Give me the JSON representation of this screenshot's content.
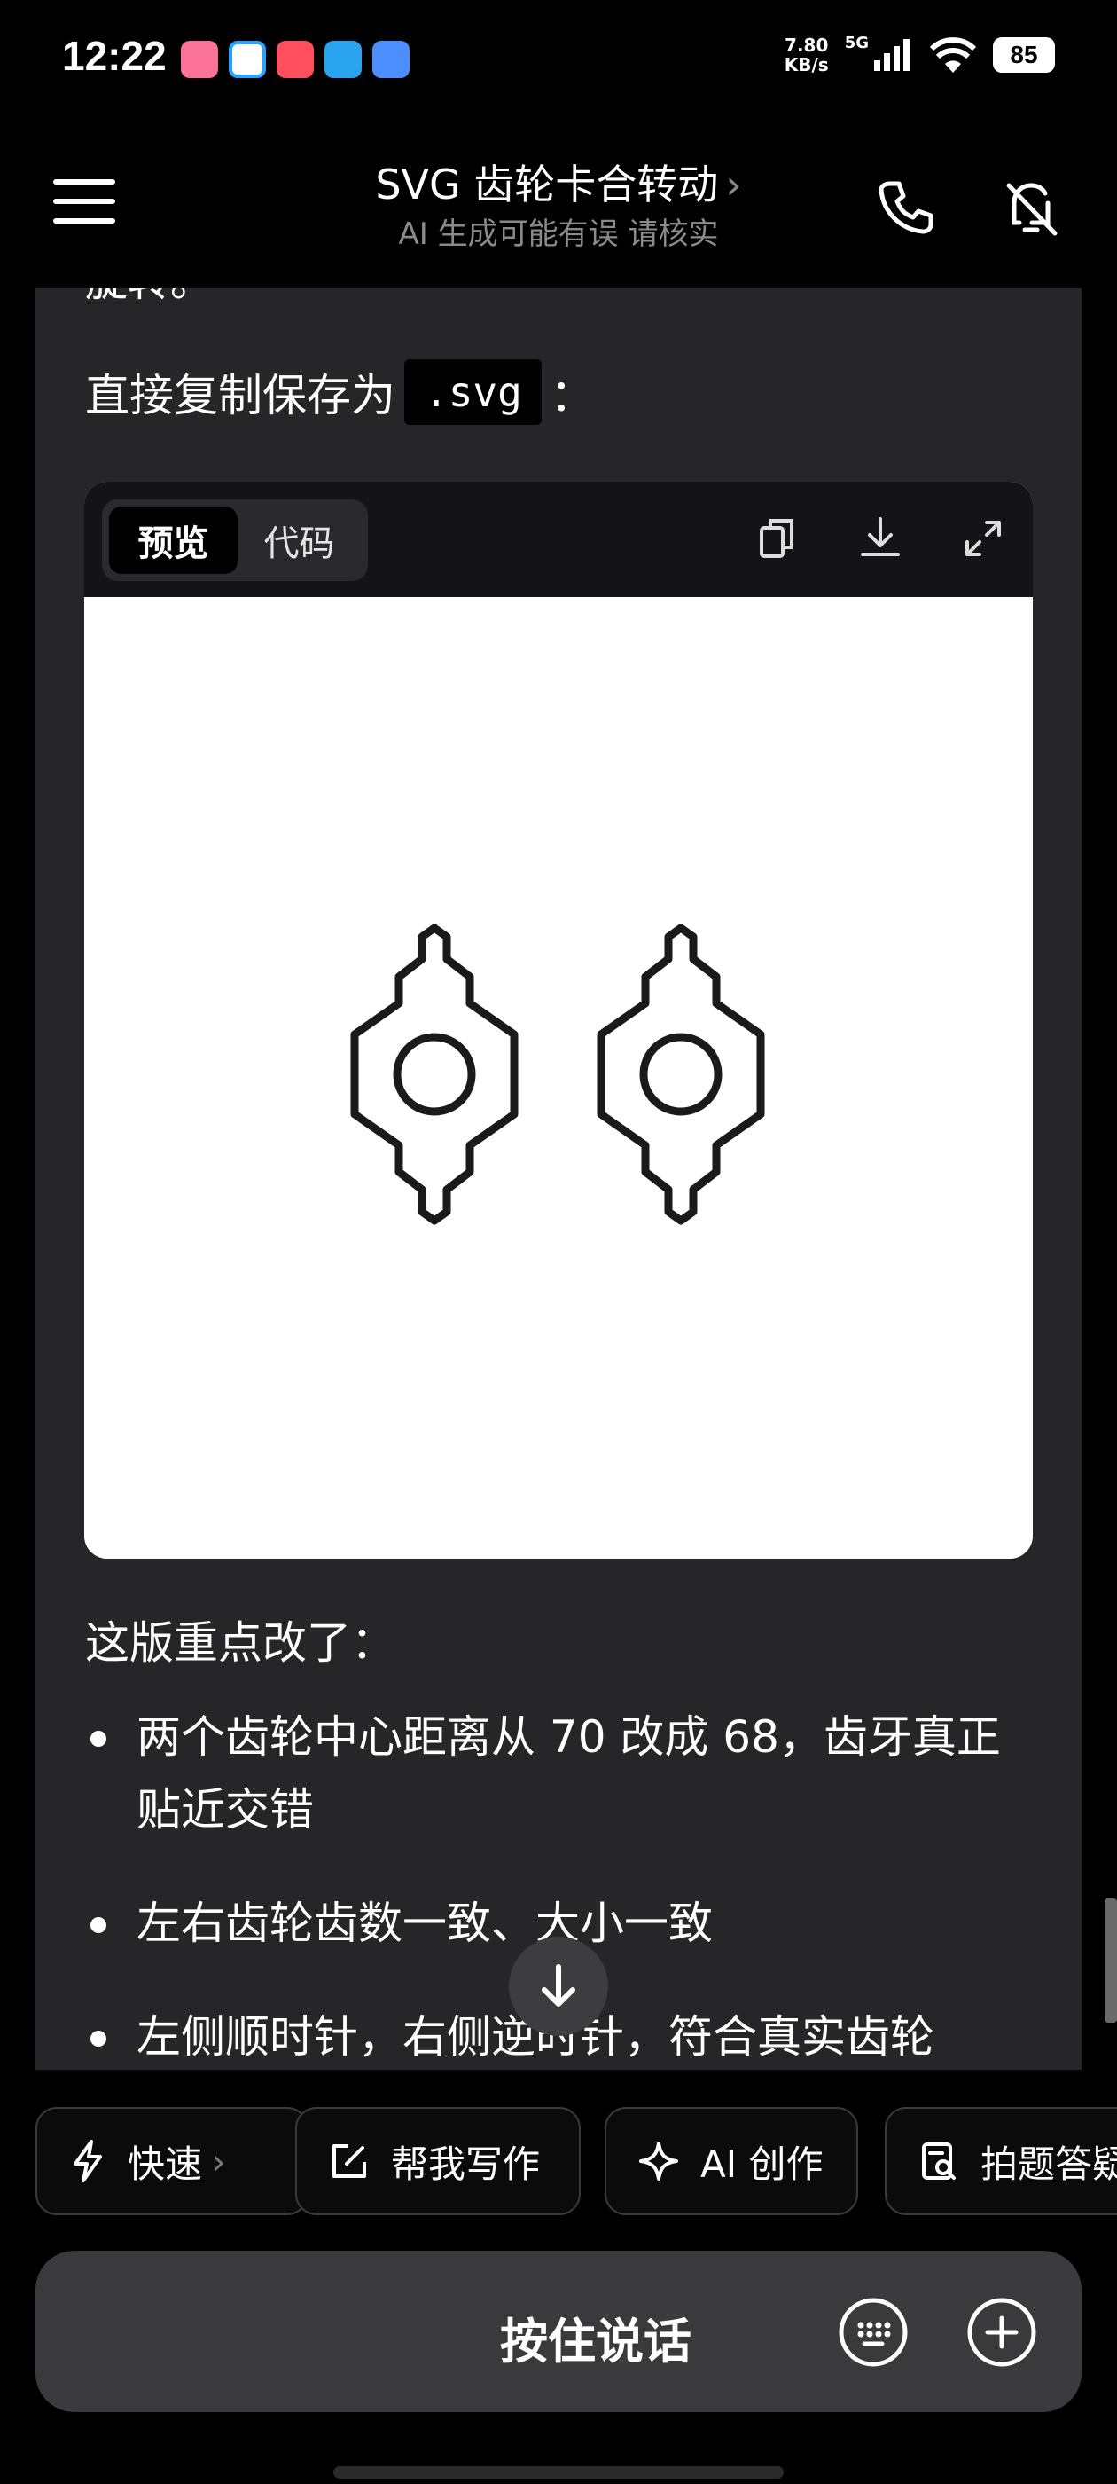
{
  "status_bar": {
    "time": "12:22",
    "net_speed_value": "7.80",
    "net_speed_unit": "KB/s",
    "signal_label": "5G",
    "battery": "85"
  },
  "nav": {
    "title": "SVG 齿轮卡合转动",
    "title_chevron": "›",
    "subtitle": "AI 生成可能有误 请核实"
  },
  "message": {
    "clipped_text": "旋转。",
    "intro_prefix": "直接复制保存为",
    "intro_code": ".svg",
    "intro_suffix": "：",
    "preview": {
      "tabs": [
        {
          "label": "预览",
          "active": true
        },
        {
          "label": "代码",
          "active": false
        }
      ],
      "tool_icons": [
        "copy-icon",
        "download-icon",
        "fullscreen-icon"
      ]
    },
    "heading": "这版重点改了：",
    "bullets": [
      "两个齿轮中心距离从 70 改成 68，齿牙真正贴近交错",
      "左右齿轮齿数一致、大小一致",
      "左侧顺时针，右侧逆时针，符合真实齿轮"
    ]
  },
  "quick_actions": [
    {
      "label": "快速",
      "icon": "lightning-icon",
      "has_chevron": true,
      "chevron": "›"
    },
    {
      "label": "帮我写作",
      "icon": "edit-icon"
    },
    {
      "label": "AI 创作",
      "icon": "sparkle-icon"
    },
    {
      "label": "拍题答疑",
      "icon": "scan-question-icon"
    }
  ],
  "input": {
    "hold_to_talk": "按住说话"
  },
  "colors": {
    "background": "#000000",
    "card": "#262628",
    "input_bar": "#3a3a3c",
    "muted_text": "#8a8a8a"
  }
}
